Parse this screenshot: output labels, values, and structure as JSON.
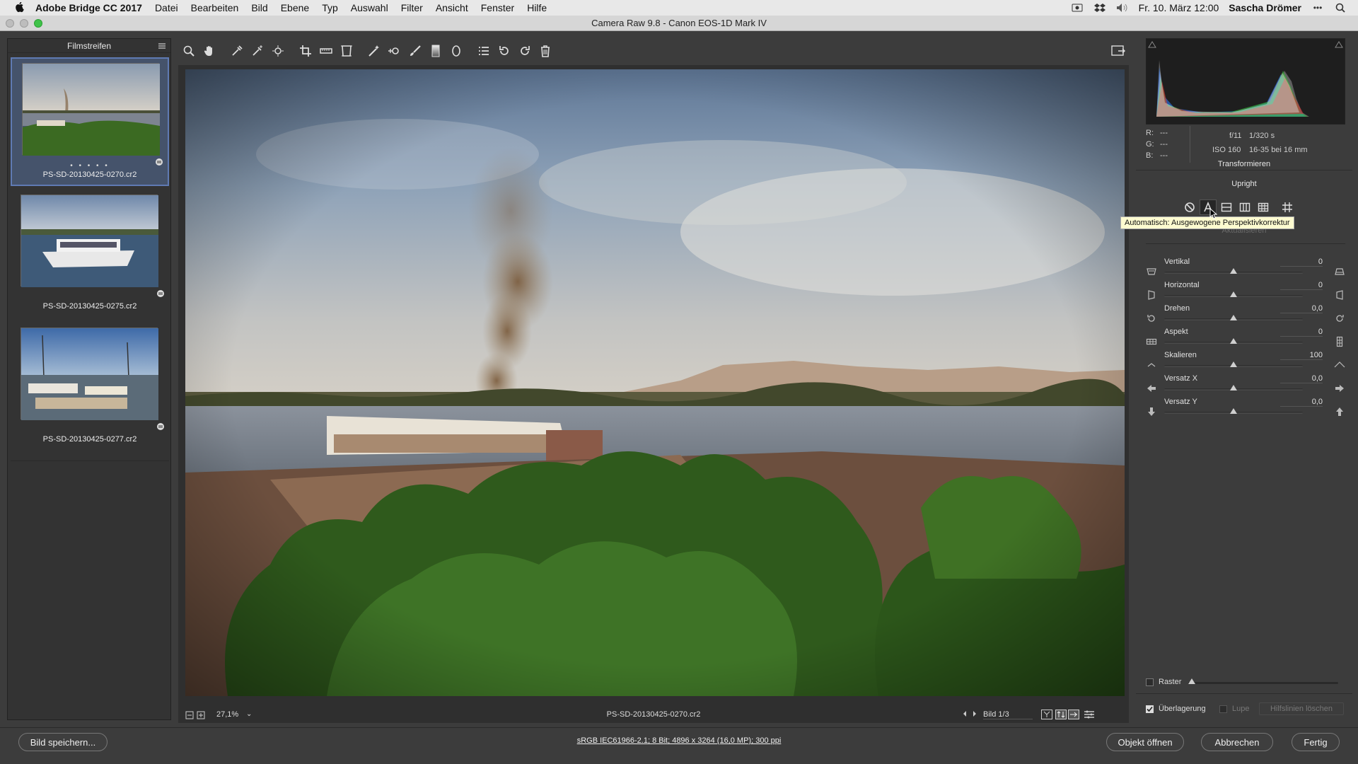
{
  "menubar": {
    "app_name": "Adobe Bridge CC 2017",
    "menus": [
      "Datei",
      "Bearbeiten",
      "Bild",
      "Ebene",
      "Typ",
      "Auswahl",
      "Filter",
      "Ansicht",
      "Fenster",
      "Hilfe"
    ],
    "datetime": "Fr. 10. März  12:00",
    "user": "Sascha Drömer"
  },
  "window": {
    "title": "Camera Raw 9.8  -  Canon EOS-1D Mark IV"
  },
  "filmstrip": {
    "title": "Filmstreifen",
    "items": [
      {
        "name": "PS-SD-20130425-0270.cr2",
        "rating_dots": "• • • • •",
        "selected": true
      },
      {
        "name": "PS-SD-20130425-0275.cr2",
        "rating_dots": "",
        "selected": false
      },
      {
        "name": "PS-SD-20130425-0277.cr2",
        "rating_dots": "",
        "selected": false
      }
    ]
  },
  "toolbar": {
    "tools": [
      "zoom-tool",
      "hand-tool",
      "white-balance-tool",
      "color-sampler-tool",
      "targeted-adjustment-tool",
      "crop-tool",
      "straighten-tool",
      "transform-tool",
      "spot-removal-tool",
      "red-eye-tool",
      "adjustment-brush-tool",
      "graduated-filter-tool",
      "radial-filter-tool",
      "preferences-tool",
      "rotate-left-tool",
      "rotate-right-tool",
      "trash-tool"
    ]
  },
  "preview": {
    "zoom": "27,1%",
    "filename": "PS-SD-20130425-0270.cr2",
    "image_counter": "Bild 1/3"
  },
  "camera_info": {
    "r": "R:",
    "g": "G:",
    "b": "B:",
    "r_val": "---",
    "g_val": "---",
    "b_val": "---",
    "aperture": "f/11",
    "shutter": "1/320 s",
    "iso": "ISO 160",
    "lens": "16-35 bei 16 mm"
  },
  "transform": {
    "panel_title": "Transformieren",
    "upright_title": "Upright",
    "update_label": "Aktualisieren",
    "tooltip": "Automatisch: Ausgewogene Perspektivkorrektur",
    "sliders": [
      {
        "label": "Vertikal",
        "value": "0",
        "position": 0.5
      },
      {
        "label": "Horizontal",
        "value": "0",
        "position": 0.5
      },
      {
        "label": "Drehen",
        "value": "0,0",
        "position": 0.5
      },
      {
        "label": "Aspekt",
        "value": "0",
        "position": 0.5
      },
      {
        "label": "Skalieren",
        "value": "100",
        "position": 0.5
      },
      {
        "label": "Versatz X",
        "value": "0,0",
        "position": 0.5
      },
      {
        "label": "Versatz Y",
        "value": "0,0",
        "position": 0.5
      }
    ],
    "raster_label": "Raster",
    "overlay_label": "Überlagerung",
    "loupe_label": "Lupe",
    "clear_guides_label": "Hilfslinien löschen"
  },
  "bottom": {
    "save_label": "Bild speichern...",
    "workflow": "sRGB IEC61966-2.1; 8 Bit; 4896 x 3264 (16,0 MP); 300 ppi",
    "open_label": "Objekt öffnen",
    "cancel_label": "Abbrechen",
    "done_label": "Fertig"
  },
  "colors": {
    "panel_bg": "#3c3c3c",
    "selection_blue": "#5f7ab3",
    "tooltip_bg": "#fdfbd0"
  }
}
